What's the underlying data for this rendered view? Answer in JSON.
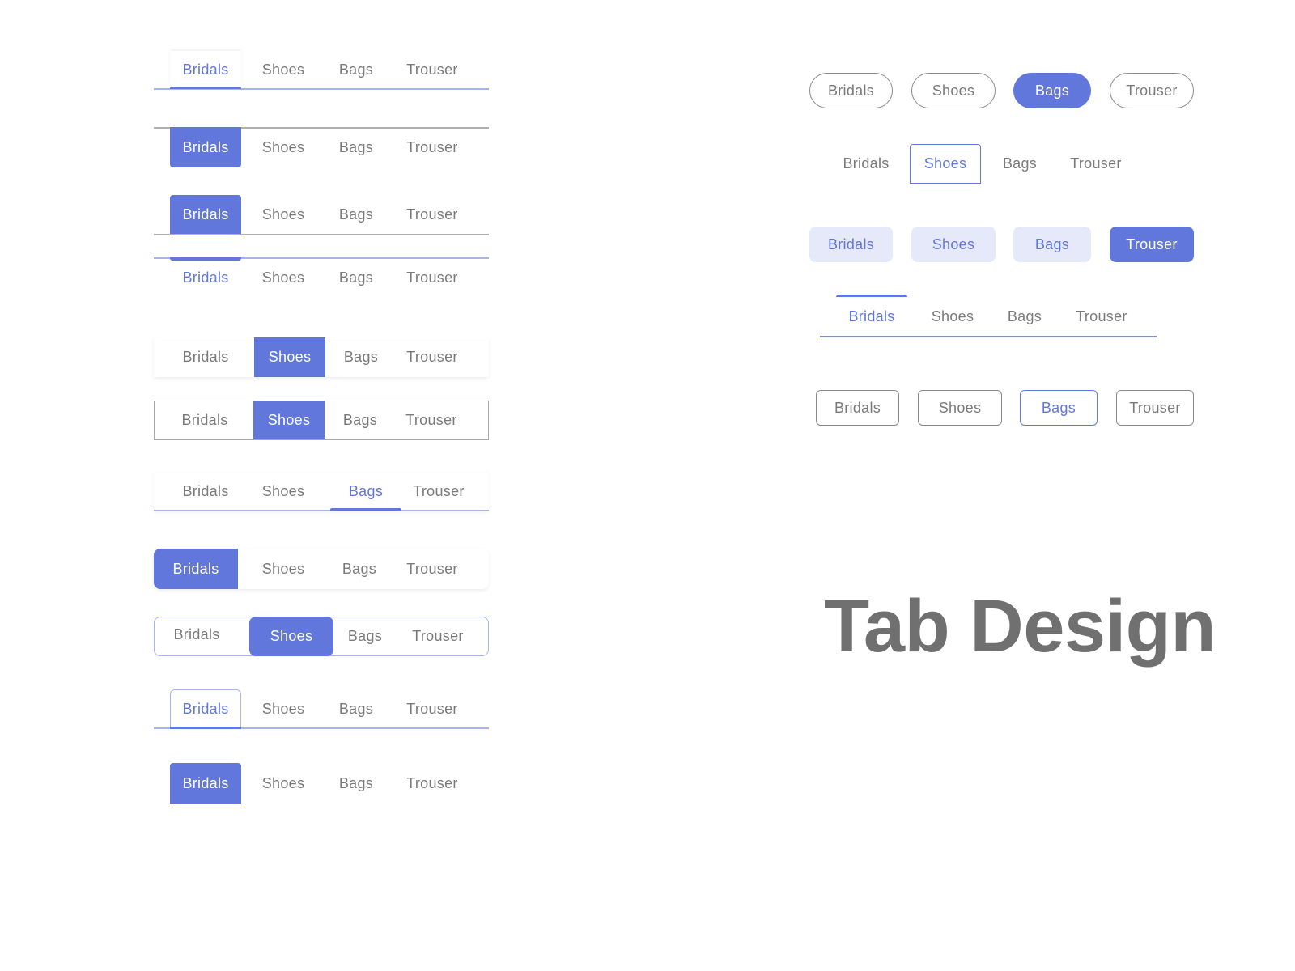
{
  "title": "Tab Design",
  "colors": {
    "accent": "#6277db",
    "accent_light_line": "#a6b4ea",
    "accent_light_fill": "#e6e9f9",
    "text_muted": "#7a7a7a",
    "neutral_line": "#b0b0b0"
  },
  "tab_labels": [
    "Bridals",
    "Shoes",
    "Bags",
    "Trouser"
  ],
  "groups": [
    {
      "id": "underline-top-shadow",
      "tabs": [
        "Bridals",
        "Shoes",
        "Bags",
        "Trouser"
      ],
      "active": "Bridals"
    },
    {
      "id": "filled-hanging",
      "tabs": [
        "Bridals",
        "Shoes",
        "Bags",
        "Trouser"
      ],
      "active": "Bridals"
    },
    {
      "id": "filled-raised",
      "tabs": [
        "Bridals",
        "Shoes",
        "Bags",
        "Trouser"
      ],
      "active": "Bridals"
    },
    {
      "id": "top-indicator",
      "tabs": [
        "Bridals",
        "Shoes",
        "Bags",
        "Trouser"
      ],
      "active": "Bridals"
    },
    {
      "id": "filled-shadow-bar",
      "tabs": [
        "Bridals",
        "Shoes",
        "Bags",
        "Trouser"
      ],
      "active": "Shoes"
    },
    {
      "id": "filled-bordered-bar",
      "tabs": [
        "Bridals",
        "Shoes",
        "Bags",
        "Trouser"
      ],
      "active": "Shoes"
    },
    {
      "id": "underline-shadow-bar",
      "tabs": [
        "Bridals",
        "Shoes",
        "Bags",
        "Trouser"
      ],
      "active": "Bags"
    },
    {
      "id": "filled-rounded-left",
      "tabs": [
        "Bridals",
        "Shoes",
        "Bags",
        "Trouser"
      ],
      "active": "Bridals"
    },
    {
      "id": "segmented-rounded",
      "tabs": [
        "Bridals",
        "Shoes",
        "Bags",
        "Trouser"
      ],
      "active": "Shoes"
    },
    {
      "id": "outlined-folder",
      "tabs": [
        "Bridals",
        "Shoes",
        "Bags",
        "Trouser"
      ],
      "active": "Bridals"
    },
    {
      "id": "filled-simple",
      "tabs": [
        "Bridals",
        "Shoes",
        "Bags",
        "Trouser"
      ],
      "active": "Bridals"
    },
    {
      "id": "pill-outline",
      "tabs": [
        "Bridals",
        "Shoes",
        "Bags",
        "Trouser"
      ],
      "active": "Bags"
    },
    {
      "id": "outline-box",
      "tabs": [
        "Bridals",
        "Shoes",
        "Bags",
        "Trouser"
      ],
      "active": "Shoes"
    },
    {
      "id": "soft-chips",
      "tabs": [
        "Bridals",
        "Shoes",
        "Bags",
        "Trouser"
      ],
      "active": "Trouser"
    },
    {
      "id": "top-bar-underline",
      "tabs": [
        "Bridals",
        "Shoes",
        "Bags",
        "Trouser"
      ],
      "active": "Bridals"
    },
    {
      "id": "rounded-outline-buttons",
      "tabs": [
        "Bridals",
        "Shoes",
        "Bags",
        "Trouser"
      ],
      "active": "Bags"
    }
  ]
}
